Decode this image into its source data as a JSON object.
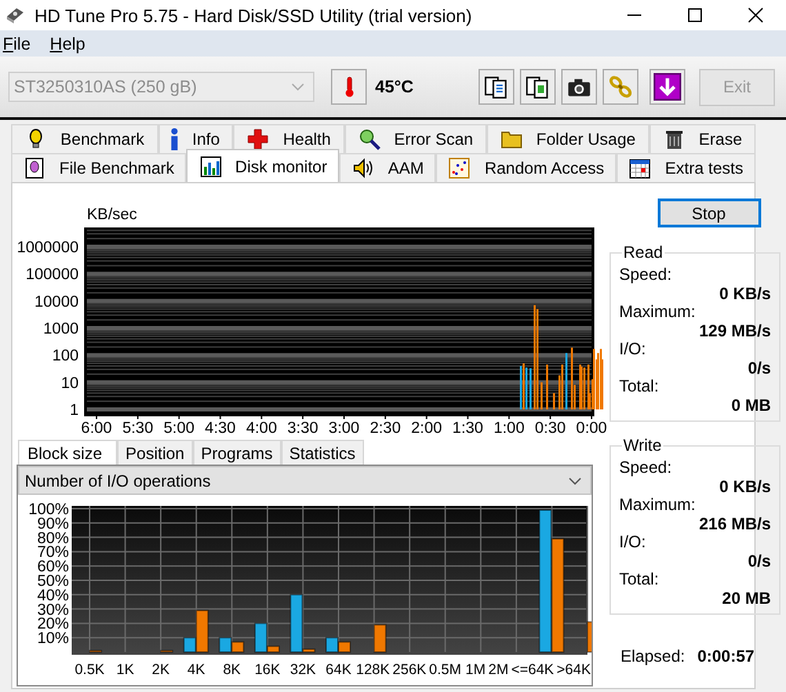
{
  "window": {
    "title": "HD Tune Pro 5.75 - Hard Disk/SSD Utility (trial version)"
  },
  "menu": [
    {
      "label": "File"
    },
    {
      "label": "Help"
    }
  ],
  "toolbar": {
    "drive": {
      "value": "ST3250310AS (250 gB)",
      "disabled": true
    },
    "temperature": "45°C",
    "exit": {
      "label": "Exit",
      "disabled": true
    }
  },
  "tabs": [
    [
      {
        "label": "Benchmark",
        "selected": false
      },
      {
        "label": "Info",
        "selected": false
      },
      {
        "label": "Health",
        "selected": false
      },
      {
        "label": "Error Scan",
        "selected": false
      },
      {
        "label": "Folder Usage",
        "selected": false
      },
      {
        "label": "Erase",
        "selected": false
      }
    ],
    [
      {
        "label": "File Benchmark",
        "selected": false
      },
      {
        "label": "Disk monitor",
        "selected": true
      },
      {
        "label": "AAM",
        "selected": false
      },
      {
        "label": "Random Access",
        "selected": false
      },
      {
        "label": "Extra tests",
        "selected": false
      }
    ]
  ],
  "monitor": {
    "unit": "KB/sec",
    "y_labels": [
      "1000000",
      "100000",
      "10000",
      "1000",
      "100",
      "10",
      "1"
    ],
    "x_labels": [
      "6:00",
      "5:30",
      "5:00",
      "4:30",
      "4:00",
      "3:30",
      "3:00",
      "2:30",
      "2:00",
      "1:30",
      "1:00",
      "0:30",
      "0:00"
    ]
  },
  "stop_button": "Stop",
  "subtabs": [
    {
      "label": "Block size",
      "selected": true
    },
    {
      "label": "Position",
      "selected": false
    },
    {
      "label": "Programs",
      "selected": false
    },
    {
      "label": "Statistics",
      "selected": false
    }
  ],
  "histogram": {
    "mode": "Number of I/O operations",
    "chart_data": {
      "type": "bar",
      "categories": [
        "0.5K",
        "1K",
        "2K",
        "4K",
        "8K",
        "16K",
        "32K",
        "64K",
        "128K",
        "256K",
        "0.5M",
        "1M",
        "2M",
        "<=64K",
        ">64K"
      ],
      "grid": true,
      "series": [
        {
          "color": "#1aa8e2",
          "values": [
            0,
            0,
            0,
            10,
            10,
            20,
            40,
            10,
            0,
            0,
            0,
            0,
            0,
            99,
            0
          ]
        },
        {
          "color": "#f07800",
          "values": [
            1,
            0,
            1,
            29,
            7,
            4,
            2,
            7,
            19,
            0,
            0,
            0,
            0,
            79,
            21
          ]
        }
      ],
      "ylim": [
        0,
        100
      ],
      "yticks": [
        {
          "value": 10,
          "label": "10%"
        },
        {
          "value": 20,
          "label": "20%"
        },
        {
          "value": 30,
          "label": "30%"
        },
        {
          "value": 40,
          "label": "40%"
        },
        {
          "value": 50,
          "label": "50%"
        },
        {
          "value": 60,
          "label": "60%"
        },
        {
          "value": 70,
          "label": "70%"
        },
        {
          "value": 80,
          "label": "80%"
        },
        {
          "value": 90,
          "label": "90%"
        },
        {
          "value": 100,
          "label": "100%"
        }
      ]
    }
  },
  "read": {
    "title": "Read",
    "rows": [
      {
        "label": "Speed:",
        "value": "0 KB/s"
      },
      {
        "label": "Maximum:",
        "value": "129 MB/s"
      },
      {
        "label": "I/O:",
        "value": "0/s"
      },
      {
        "label": "Total:",
        "value": "0 MB"
      }
    ]
  },
  "write": {
    "title": "Write",
    "rows": [
      {
        "label": "Speed:",
        "value": "0 KB/s"
      },
      {
        "label": "Maximum:",
        "value": "216 MB/s"
      },
      {
        "label": "I/O:",
        "value": "0/s"
      },
      {
        "label": "Total:",
        "value": "20 MB"
      }
    ]
  },
  "elapsed": {
    "label": "Elapsed:",
    "value": "0:00:57"
  }
}
